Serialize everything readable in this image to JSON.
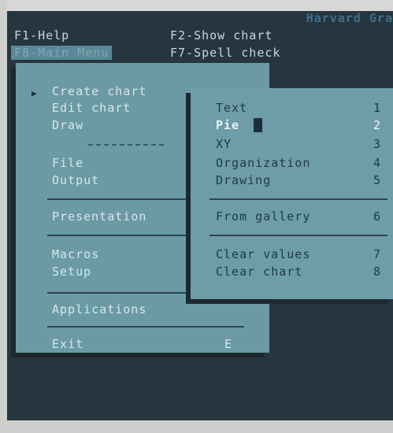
{
  "app": {
    "title": "Harvard Gra"
  },
  "fkeys": {
    "f1": "F1-Help",
    "f2": "F2-Show chart",
    "f8": "F8-Main Menu",
    "f7": "F7-Spell check"
  },
  "main_menu": {
    "create_chart": "Create chart",
    "edit_chart": "Edit chart",
    "draw": "Draw",
    "file": "File",
    "output": "Output",
    "presentation": "Presentation",
    "macros": "Macros",
    "setup": "Setup",
    "applications": "Applications",
    "exit": "Exit",
    "exit_key": "E"
  },
  "sub_menu": {
    "text": "Text",
    "text_key": "1",
    "pie": "Pie",
    "pie_key": "2",
    "xy": "XY",
    "xy_key": "3",
    "organization": "Organization",
    "organization_key": "4",
    "drawing": "Drawing",
    "drawing_key": "5",
    "from_gallery": "From gallery",
    "from_gallery_key": "6",
    "clear_values": "Clear values",
    "clear_values_key": "7",
    "clear_chart": "Clear chart",
    "clear_chart_key": "8"
  }
}
